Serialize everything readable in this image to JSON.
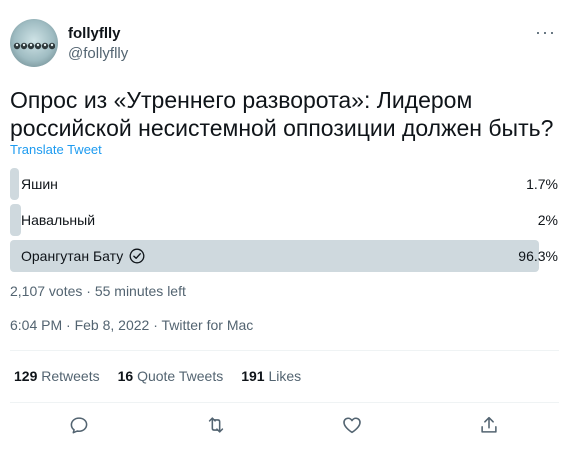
{
  "user": {
    "name": "follyflly",
    "handle": "@follyflly",
    "more": "···"
  },
  "tweet": {
    "text": "Опрос из «Утреннего разворота»: Лидером российской несистемной оппозиции должен быть?",
    "translate": "Translate Tweet"
  },
  "poll": {
    "options": [
      {
        "label": "Яшин",
        "percent": "1.7%",
        "share": 1.7,
        "winner": false
      },
      {
        "label": "Навальный",
        "percent": "2%",
        "share": 2.0,
        "winner": false
      },
      {
        "label": "Орангутан Бату",
        "percent": "96.3%",
        "share": 96.3,
        "winner": true
      }
    ],
    "summary": "2,107 votes · 55 minutes left"
  },
  "meta": "6:04 PM · Feb 8, 2022 · Twitter for Mac",
  "stats": {
    "retweets_count": "129",
    "retweets_label": "Retweets",
    "quotes_count": "16",
    "quotes_label": "Quote Tweets",
    "likes_count": "191",
    "likes_label": "Likes"
  },
  "colors": {
    "bar": "#cfd9de",
    "accent": "#1d9bf0",
    "muted": "#536471"
  },
  "icons": [
    "reply-icon",
    "retweet-icon",
    "like-icon",
    "share-icon",
    "check-circle-icon"
  ]
}
